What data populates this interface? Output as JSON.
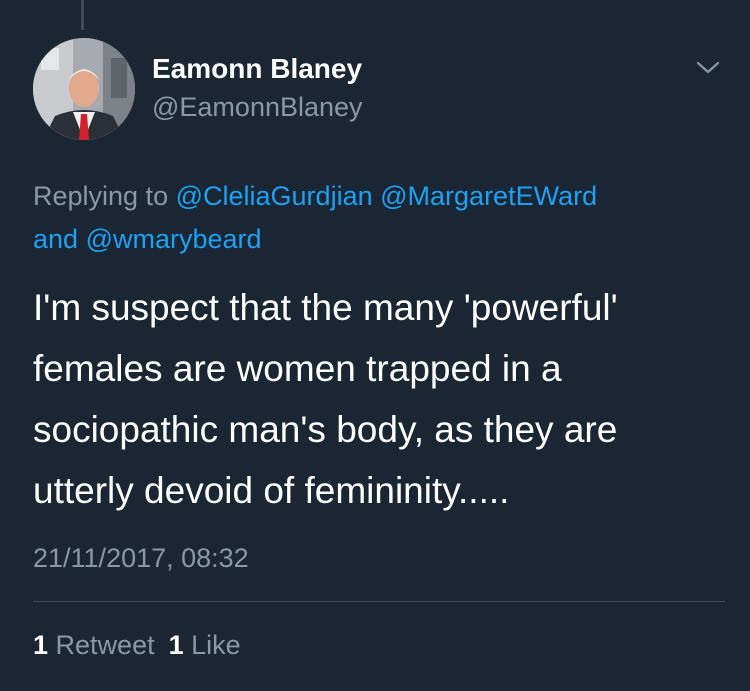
{
  "tweet": {
    "author": {
      "display_name": "Eamonn Blaney",
      "handle": "@EamonnBlaney"
    },
    "menu_icon": "chevron-down-icon",
    "reply_prefix": "Replying to",
    "reply_mentions": [
      "@CleliaGurdjian",
      "@MargaretEWard",
      "@wmarybeard"
    ],
    "reply_conjunction": "and",
    "text_lines": [
      "I'm suspect that the many 'powerful'",
      "females are women trapped in a",
      "sociopathic man's body, as they are",
      "utterly devoid of femininity....."
    ],
    "timestamp": "21/11/2017, 08:32",
    "stats": {
      "retweets_count": "1",
      "retweets_label": "Retweet",
      "likes_count": "1",
      "likes_label": "Like"
    }
  },
  "colors": {
    "background": "#1b2634",
    "link": "#1da1f2",
    "secondary_text": "#8899a6"
  }
}
